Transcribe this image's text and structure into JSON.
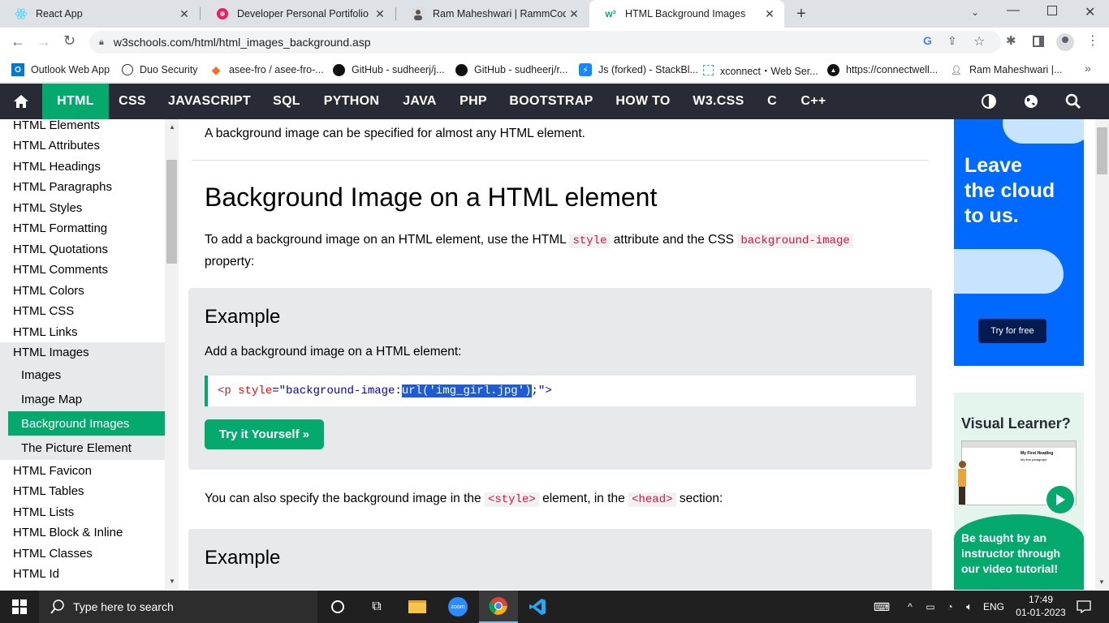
{
  "tabs": [
    {
      "title": "React App",
      "icon": "react-icon",
      "color": "#61dafb"
    },
    {
      "title": "Developer Personal Portifolio - W",
      "icon": "portfolio-icon",
      "color": "#e91e63"
    },
    {
      "title": "Ram Maheshwari | RammCodes |",
      "icon": "avatar-icon",
      "color": "#555555"
    },
    {
      "title": "HTML Background Images",
      "icon": "w3schools-icon",
      "color": "#04aa6d"
    }
  ],
  "address": {
    "url": "w3schools.com/html/html_images_background.asp"
  },
  "bookmarks": [
    {
      "label": "Outlook Web App",
      "icon": "outlook-icon"
    },
    {
      "label": "Duo Security",
      "icon": "duo-icon"
    },
    {
      "label": "asee-fro / asee-fro-...",
      "icon": "gitlab-icon"
    },
    {
      "label": "GitHub - sudheerj/j...",
      "icon": "github-icon"
    },
    {
      "label": "GitHub - sudheerj/r...",
      "icon": "github-icon"
    },
    {
      "label": "Js (forked) - StackBl...",
      "icon": "stackblitz-icon"
    },
    {
      "label": "xconnect・Web Ser...",
      "icon": "xconnect-icon"
    },
    {
      "label": "https://connectwell...",
      "icon": "connect-icon"
    },
    {
      "label": "Ram Maheshwari |...",
      "icon": "avatar-icon"
    }
  ],
  "nav": {
    "items": [
      "HTML",
      "CSS",
      "JAVASCRIPT",
      "SQL",
      "PYTHON",
      "JAVA",
      "PHP",
      "BOOTSTRAP",
      "HOW TO",
      "W3.CSS",
      "C",
      "C++"
    ],
    "active": "HTML"
  },
  "sidebar": {
    "items": [
      "HTML Elements",
      "HTML Attributes",
      "HTML Headings",
      "HTML Paragraphs",
      "HTML Styles",
      "HTML Formatting",
      "HTML Quotations",
      "HTML Comments",
      "HTML Colors",
      "HTML CSS",
      "HTML Links",
      "HTML Images"
    ],
    "sub_items": [
      "Images",
      "Image Map",
      "Background Images",
      "The Picture Element"
    ],
    "selected": "Background Images",
    "after": [
      "HTML Favicon",
      "HTML Tables",
      "HTML Lists",
      "HTML Block & Inline",
      "HTML Classes",
      "HTML Id"
    ]
  },
  "main": {
    "intro": "A background image can be specified for almost any HTML element.",
    "heading": "Background Image on a HTML element",
    "para1_a": "To add a background image on an HTML element, use the HTML",
    "para1_code1": "style",
    "para1_b": "attribute and the CSS",
    "para1_code2": "background-image",
    "para1_c": "property:",
    "example1": {
      "title": "Example",
      "desc": "Add a background image on a HTML element:",
      "code_tag": "<p",
      "code_attr": "style",
      "code_eq": "=\"background-image: ",
      "code_sel": "url('img_girl.jpg')",
      "code_end": ";\">",
      "button": "Try it Yourself »"
    },
    "para2_a": "You can also specify the background image in the",
    "para2_code1": "<style>",
    "para2_b": "element, in the",
    "para2_code2": "<head>",
    "para2_c": "section:",
    "example2": {
      "title": "Example"
    }
  },
  "ads": {
    "ad1": {
      "line1": "Leave",
      "line2": "the cloud",
      "line3": "to us.",
      "button": "Try for free"
    },
    "ad2": {
      "title": "Visual Learner?",
      "line1": "Be taught by an",
      "line2": "instructor through",
      "line3": "our video tutorial!",
      "mini_title": "My First Heading",
      "mini_text": "My first paragraph."
    }
  },
  "taskbar": {
    "search_placeholder": "Type here to search",
    "lang": "ENG",
    "time": "17:49",
    "date": "01-01-2023"
  },
  "colors": {
    "w3_green": "#04aa6d",
    "w3_dark": "#282a35",
    "ad_blue": "#0069ff"
  }
}
